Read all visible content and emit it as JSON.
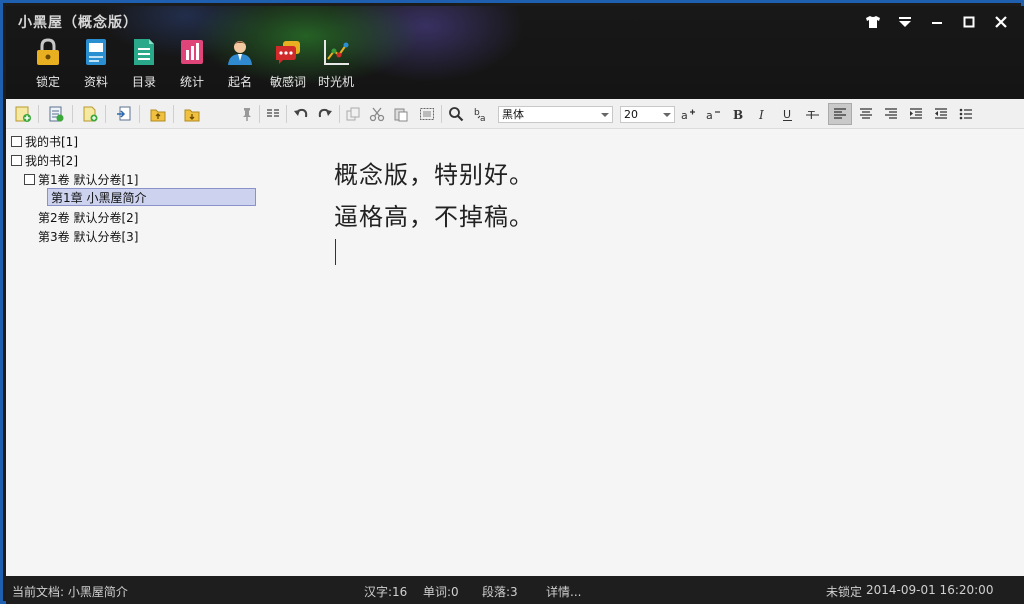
{
  "window": {
    "title": "小黑屋（概念版）",
    "controls": [
      "skin-icon",
      "menu-icon",
      "minimize-icon",
      "maximize-icon",
      "close-icon"
    ]
  },
  "tools": [
    {
      "name": "lock",
      "label": "锁定",
      "icon": "lock-icon",
      "color": "#e8b020"
    },
    {
      "name": "info",
      "label": "资料",
      "icon": "book-icon",
      "color": "#2a8fd0"
    },
    {
      "name": "catalog",
      "label": "目录",
      "icon": "catalog-icon",
      "color": "#2aa88a"
    },
    {
      "name": "stats",
      "label": "统计",
      "icon": "chart-icon",
      "color": "#e0457a"
    },
    {
      "name": "naming",
      "label": "起名",
      "icon": "person-icon",
      "color": "#e08a3a"
    },
    {
      "name": "sensitive",
      "label": "敏感词",
      "icon": "chat-icon",
      "color": "#d02a2a"
    },
    {
      "name": "timemachine",
      "label": "时光机",
      "icon": "timeline-icon",
      "color": "#3a9a3a"
    }
  ],
  "toolbar": {
    "font_name": "黑体",
    "font_size": "20"
  },
  "tree": {
    "items": [
      {
        "label": "我的书[1]",
        "level": 0,
        "checkbox": true,
        "selected": false
      },
      {
        "label": "我的书[2]",
        "level": 0,
        "checkbox": true,
        "selected": false
      },
      {
        "label": "第1卷 默认分卷[1]",
        "level": 1,
        "checkbox": true,
        "selected": false
      },
      {
        "label": "第1章 小黑屋简介",
        "level": 2,
        "checkbox": false,
        "selected": true
      },
      {
        "label": "第2卷 默认分卷[2]",
        "level": 1,
        "checkbox": false,
        "selected": false
      },
      {
        "label": "第3卷 默认分卷[3]",
        "level": 1,
        "checkbox": false,
        "selected": false
      }
    ]
  },
  "editor": {
    "lines": [
      "概念版，特别好。",
      "逼格高，不掉稿。"
    ]
  },
  "status": {
    "current_doc": "当前文档: 小黑屋简介",
    "chars": "汉字:16",
    "words": "单词:0",
    "paragraphs": "段落:3",
    "details": "详情...",
    "lock_state": "未锁定",
    "datetime": "2014-09-01 16:20:00"
  }
}
